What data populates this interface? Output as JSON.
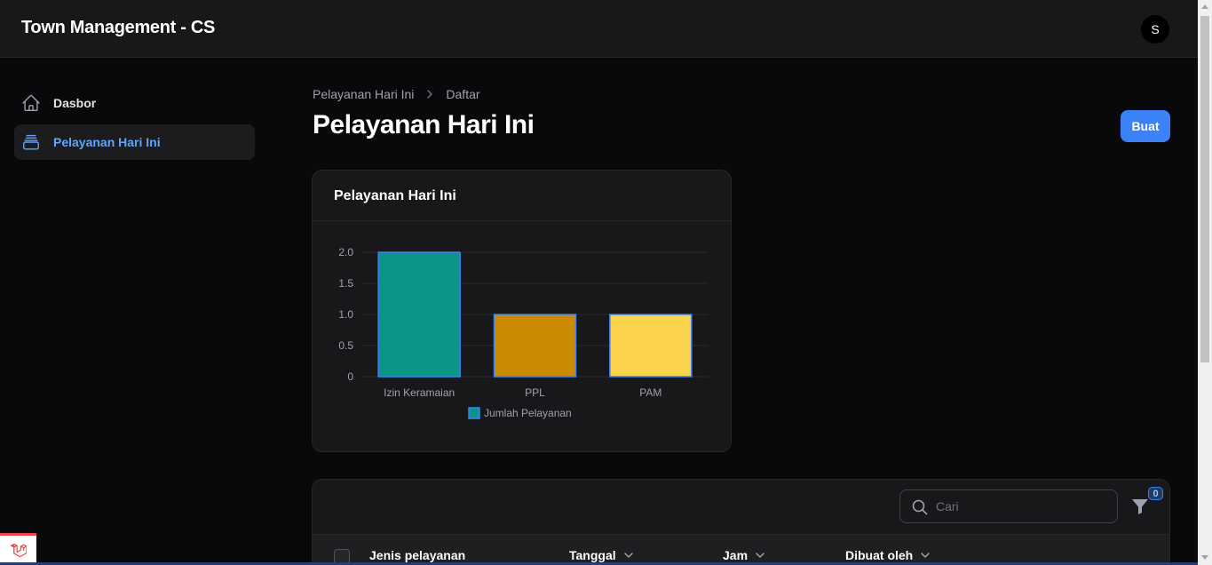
{
  "app": {
    "title": "Town Management - CS",
    "avatar_initial": "S"
  },
  "sidebar": {
    "items": [
      {
        "label": "Dasbor",
        "icon": "home-icon",
        "active": false
      },
      {
        "label": "Pelayanan Hari Ini",
        "icon": "inbox-stack-icon",
        "active": true
      }
    ]
  },
  "breadcrumb": {
    "items": [
      "Pelayanan Hari Ini",
      "Daftar"
    ]
  },
  "page": {
    "title": "Pelayanan Hari Ini",
    "create_button": "Buat"
  },
  "widget": {
    "title": "Pelayanan Hari Ini"
  },
  "chart_data": {
    "type": "bar",
    "categories": [
      "Izin Keramaian",
      "PPL",
      "PAM"
    ],
    "series": [
      {
        "name": "Jumlah Pelayanan",
        "values": [
          2,
          1,
          1
        ],
        "colors": [
          "#0d9488",
          "#ca8a04",
          "#fcd34d"
        ]
      }
    ],
    "ylim": [
      0,
      2
    ],
    "yticks": [
      "0",
      "0.5",
      "1.0",
      "1.5",
      "2.0"
    ],
    "grid": true,
    "legend_position": "bottom",
    "border_color": "#3b82f6"
  },
  "table": {
    "search_placeholder": "Cari",
    "filter_count": "0",
    "columns": [
      {
        "label": "Jenis pelayanan",
        "sortable": false
      },
      {
        "label": "Tanggal",
        "sortable": true
      },
      {
        "label": "Jam",
        "sortable": true
      },
      {
        "label": "Dibuat oleh",
        "sortable": true
      }
    ]
  },
  "colors": {
    "accent": "#3b82f6",
    "active_nav": "#60a5fa",
    "background": "#09090b",
    "card": "#18181b"
  }
}
